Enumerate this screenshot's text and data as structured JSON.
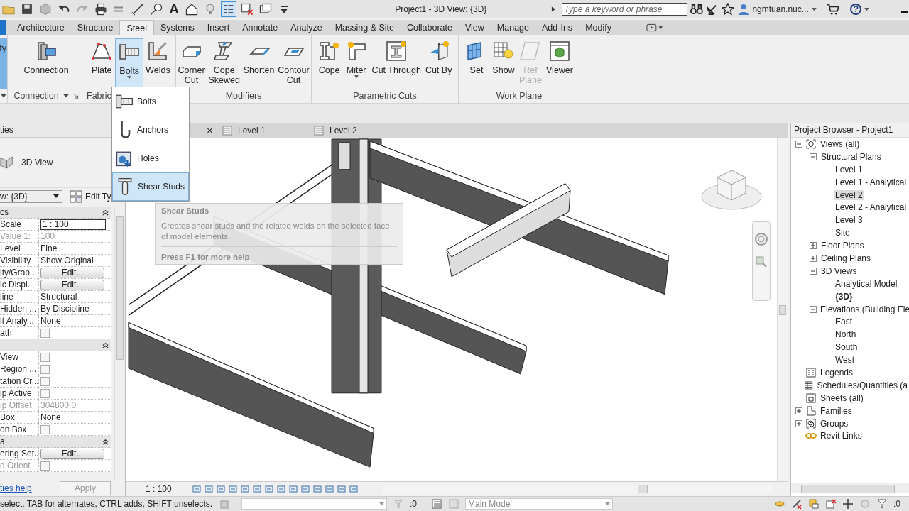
{
  "title_bar": {
    "quick_access": [
      {
        "kind": "open",
        "selected": false
      },
      {
        "kind": "save",
        "selected": false
      },
      {
        "kind": "sync",
        "selected": false
      },
      {
        "kind": "undo",
        "selected": false
      },
      {
        "kind": "redo",
        "selected": false
      },
      {
        "kind": "print",
        "selected": false
      },
      {
        "kind": "align",
        "selected": false
      },
      {
        "kind": "dimension",
        "selected": false
      },
      {
        "kind": "tag",
        "selected": false
      },
      {
        "kind": "text",
        "glyph": "A",
        "selected": false
      },
      {
        "kind": "house",
        "selected": false
      },
      {
        "kind": "bulb",
        "selected": false
      },
      {
        "kind": "thinlines",
        "selected": true
      },
      {
        "kind": "closewin",
        "selected": false
      },
      {
        "kind": "switchwin",
        "selected": false
      },
      {
        "kind": "customize",
        "selected": false
      }
    ],
    "title": "Project1 - 3D View: {3D}",
    "search": {
      "placeholder": "Type a keyword or phrase"
    },
    "user": "ngmtuan.nuc...",
    "help": "?"
  },
  "tabs": [
    {
      "label": "Architecture",
      "selected": false
    },
    {
      "label": "Structure",
      "selected": false
    },
    {
      "label": "Steel",
      "selected": true
    },
    {
      "label": "Systems",
      "selected": false
    },
    {
      "label": "Insert",
      "selected": false
    },
    {
      "label": "Annotate",
      "selected": false
    },
    {
      "label": "Analyze",
      "selected": false
    },
    {
      "label": "Massing & Site",
      "selected": false
    },
    {
      "label": "Collaborate",
      "selected": false
    },
    {
      "label": "View",
      "selected": false
    },
    {
      "label": "Manage",
      "selected": false
    },
    {
      "label": "Add-Ins",
      "selected": false
    },
    {
      "label": "Modify",
      "selected": false
    }
  ],
  "ribbon": [
    {
      "menu": true,
      "buttons": [
        {
          "label": "fy",
          "kind": "modify",
          "selected": true,
          "disabled": false
        }
      ]
    },
    {
      "label": "Connection",
      "menu": true,
      "launcher": true,
      "buttons": [
        {
          "label": "Connection",
          "kind": "connection",
          "selected": false,
          "disabled": false
        }
      ]
    },
    {
      "label": "Fabric",
      "buttons": [
        {
          "label": "Plate",
          "kind": "plate",
          "selected": false,
          "disabled": false
        },
        {
          "label": "Bolts",
          "kind": "bolt",
          "selected": true,
          "disabled": false,
          "dropdown": true
        },
        {
          "label": "Welds",
          "kind": "weld",
          "selected": false,
          "disabled": false
        }
      ]
    },
    {
      "label": "Modifiers",
      "buttons": [
        {
          "label": "Corner\nCut",
          "kind": "cornercut",
          "selected": false,
          "disabled": false
        },
        {
          "label": "Cope\nSkewed",
          "kind": "copeskewed",
          "selected": false,
          "disabled": false
        },
        {
          "label": "Shorten",
          "kind": "shorten",
          "selected": false,
          "disabled": false
        },
        {
          "label": "Contour\nCut",
          "kind": "contour",
          "selected": false,
          "disabled": false
        }
      ]
    },
    {
      "label": "Parametric Cuts",
      "buttons": [
        {
          "label": "Cope",
          "kind": "cope",
          "selected": false,
          "disabled": false
        },
        {
          "label": "Miter",
          "kind": "miter",
          "selected": false,
          "disabled": false,
          "dropdown": true
        },
        {
          "label": "Cut Through",
          "kind": "cutthrough",
          "selected": false,
          "disabled": false
        },
        {
          "label": "Cut By",
          "kind": "cutby",
          "selected": false,
          "disabled": false
        }
      ]
    },
    {
      "label": "Work Plane",
      "buttons": [
        {
          "label": "Set",
          "kind": "set",
          "selected": false,
          "disabled": false
        },
        {
          "label": "Show",
          "kind": "show",
          "selected": false,
          "disabled": false
        },
        {
          "label": "Ref\nPlane",
          "kind": "refplane",
          "selected": false,
          "disabled": true
        },
        {
          "label": "Viewer",
          "kind": "viewer",
          "selected": false,
          "disabled": false
        }
      ]
    }
  ],
  "bolts_menu": [
    {
      "label": "Bolts",
      "kind": "bolt",
      "selected": false
    },
    {
      "label": "Anchors",
      "kind": "anchor",
      "selected": false
    },
    {
      "label": "Holes",
      "kind": "hole",
      "selected": false
    },
    {
      "label": "Shear Studs",
      "kind": "stud",
      "selected": true
    }
  ],
  "tooltip": {
    "title": "Shear Studs",
    "text": "Creates shear studs and the related welds on the selected face of model elements.",
    "help": "Press F1 for more help"
  },
  "properties": {
    "title": "ties",
    "type_name": "3D View",
    "selector": "w: {3D}",
    "edit_type": "Edit Ty",
    "rows": [
      {
        "kind": "section",
        "label": "cs"
      },
      {
        "kind": "input",
        "label": "Scale",
        "value": "1 : 100"
      },
      {
        "kind": "text",
        "label": "Value   1:",
        "value": "100",
        "disabled": true
      },
      {
        "kind": "text",
        "label": "Level",
        "value": "Fine",
        "disabled": false
      },
      {
        "kind": "text",
        "label": "Visibility",
        "value": "Show Original",
        "disabled": false
      },
      {
        "kind": "button",
        "label": "ity/Grap...",
        "value": "Edit..."
      },
      {
        "kind": "button",
        "label": "ic Displ...",
        "value": "Edit..."
      },
      {
        "kind": "text",
        "label": "line",
        "value": "Structural",
        "disabled": false
      },
      {
        "kind": "text",
        "label": "Hidden ...",
        "value": "By Discipline",
        "disabled": false
      },
      {
        "kind": "text",
        "label": "lt Analy...",
        "value": "None",
        "disabled": false
      },
      {
        "kind": "check",
        "label": "ath",
        "checked": false,
        "disabled": false
      },
      {
        "kind": "section"
      },
      {
        "kind": "check",
        "label": "View",
        "checked": false,
        "disabled": false
      },
      {
        "kind": "check",
        "label": "Region ...",
        "checked": false,
        "disabled": false
      },
      {
        "kind": "check",
        "label": "tation Cr...",
        "checked": false,
        "disabled": false
      },
      {
        "kind": "check",
        "label": "ip Active",
        "checked": false,
        "disabled": false
      },
      {
        "kind": "text",
        "label": "ip Offset",
        "value": "304800.0",
        "disabled": true
      },
      {
        "kind": "text",
        "label": "Box",
        "value": "None",
        "disabled": false
      },
      {
        "kind": "check",
        "label": "on Box",
        "checked": false,
        "disabled": false
      },
      {
        "kind": "section",
        "label": "a"
      },
      {
        "kind": "button",
        "label": "ering Set...",
        "value": "Edit..."
      },
      {
        "kind": "check",
        "label": "d Orient",
        "checked": false,
        "disabled": true
      }
    ],
    "help_link": "ties help",
    "apply": "Apply"
  },
  "view": {
    "close": "×",
    "tabs": [
      {
        "label": "Level 1"
      },
      {
        "label": "Level 2"
      }
    ],
    "scale": "1 : 100"
  },
  "browser": {
    "title": "Project Browser - Project1",
    "tree": [
      {
        "label": "Views (all)",
        "kind": "views",
        "expanded": true,
        "selected": false,
        "current": false,
        "children": [
          {
            "label": "Structural Plans",
            "expanded": true,
            "selected": false,
            "current": false,
            "children": [
              {
                "label": "Level 1",
                "selected": false,
                "current": false
              },
              {
                "label": "Level 1 - Analytical",
                "selected": false,
                "current": false
              },
              {
                "label": "Level 2",
                "selected": true,
                "current": false
              },
              {
                "label": "Level 2 - Analytical",
                "selected": false,
                "current": false
              },
              {
                "label": "Level 3",
                "selected": false,
                "current": false
              },
              {
                "label": "Site",
                "selected": false,
                "current": false
              }
            ]
          },
          {
            "label": "Floor Plans",
            "expanded": false,
            "selected": false,
            "current": false
          },
          {
            "label": "Ceiling Plans",
            "expanded": false,
            "selected": false,
            "current": false
          },
          {
            "label": "3D Views",
            "expanded": true,
            "selected": false,
            "current": false,
            "children": [
              {
                "label": "Analytical Model",
                "selected": false,
                "current": false
              },
              {
                "label": "{3D}",
                "selected": false,
                "current": true
              }
            ]
          },
          {
            "label": "Elevations (Building Ele",
            "expanded": true,
            "selected": false,
            "current": false,
            "children": [
              {
                "label": "East",
                "selected": false,
                "current": false
              },
              {
                "label": "North",
                "selected": false,
                "current": false
              },
              {
                "label": "South",
                "selected": false,
                "current": false
              },
              {
                "label": "West",
                "selected": false,
                "current": false
              }
            ]
          }
        ]
      },
      {
        "label": "Legends",
        "kind": "legends",
        "selected": false,
        "current": false
      },
      {
        "label": "Schedules/Quantities (a",
        "kind": "schedules",
        "selected": false,
        "current": false
      },
      {
        "label": "Sheets (all)",
        "kind": "sheets",
        "selected": false,
        "current": false
      },
      {
        "label": "Families",
        "kind": "families",
        "expanded": false,
        "selected": false,
        "current": false
      },
      {
        "label": "Groups",
        "kind": "groups",
        "expanded": false,
        "selected": false,
        "current": false
      },
      {
        "label": "Revit Links",
        "kind": "links",
        "selected": false,
        "current": false
      }
    ]
  },
  "status_bar": {
    "message": "select, TAB for alternates, CTRL adds, SHIFT unselects.",
    "filter_count": ":0",
    "model": "Main Model",
    "selection_count": ":0"
  }
}
